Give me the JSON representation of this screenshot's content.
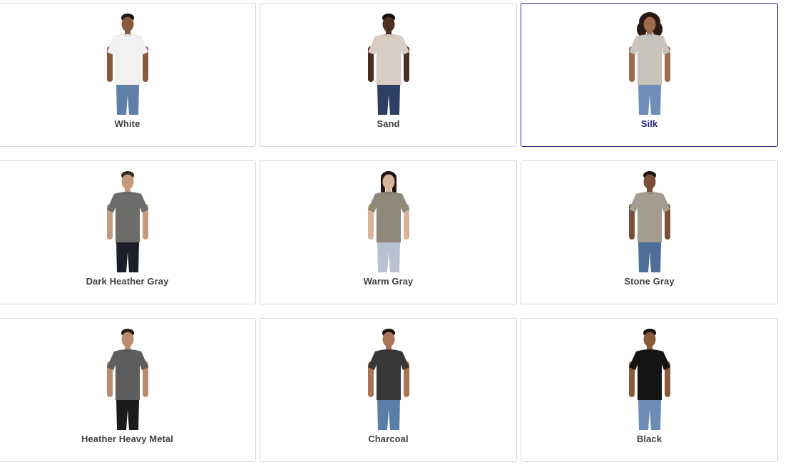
{
  "selected_index": 2,
  "colors": [
    {
      "name": "White",
      "shirt": "#f1f1f1",
      "pants": "#5d7fa8",
      "skin": "#8a5a3c",
      "hair": "#1c1410",
      "hair_style": "short"
    },
    {
      "name": "Sand",
      "shirt": "#d9cdc3",
      "pants": "#2e3f66",
      "skin": "#4a2f22",
      "hair": "#140e0b",
      "hair_style": "short"
    },
    {
      "name": "Silk",
      "shirt": "#c9c3be",
      "pants": "#6f8eb8",
      "skin": "#9c6b4c",
      "hair": "#2a1a12",
      "hair_style": "curly"
    },
    {
      "name": "Dark Heather Gray",
      "shirt": "#6c6c6a",
      "pants": "#1c1f29",
      "skin": "#c59a7c",
      "hair": "#3a2a20",
      "hair_style": "short"
    },
    {
      "name": "Warm Gray",
      "shirt": "#8f8979",
      "pants": "#b9c2d3",
      "skin": "#d8b49a",
      "hair": "#1d1612",
      "hair_style": "long"
    },
    {
      "name": "Stone Gray",
      "shirt": "#a39d8f",
      "pants": "#4e6f98",
      "skin": "#7a5038",
      "hair": "#1b1410",
      "hair_style": "short"
    },
    {
      "name": "Heather Heavy Metal",
      "shirt": "#5e5e5e",
      "pants": "#1b1b1e",
      "skin": "#b98c6d",
      "hair": "#241a14",
      "hair_style": "short"
    },
    {
      "name": "Charcoal",
      "shirt": "#383838",
      "pants": "#5b7ea8",
      "skin": "#a87656",
      "hair": "#1a120e",
      "hair_style": "short"
    },
    {
      "name": "Black",
      "shirt": "#141414",
      "pants": "#6e8db6",
      "skin": "#8b5a3d",
      "hair": "#140e0b",
      "hair_style": "short"
    }
  ],
  "photo_icon": "model-wearing-shirt-icon"
}
